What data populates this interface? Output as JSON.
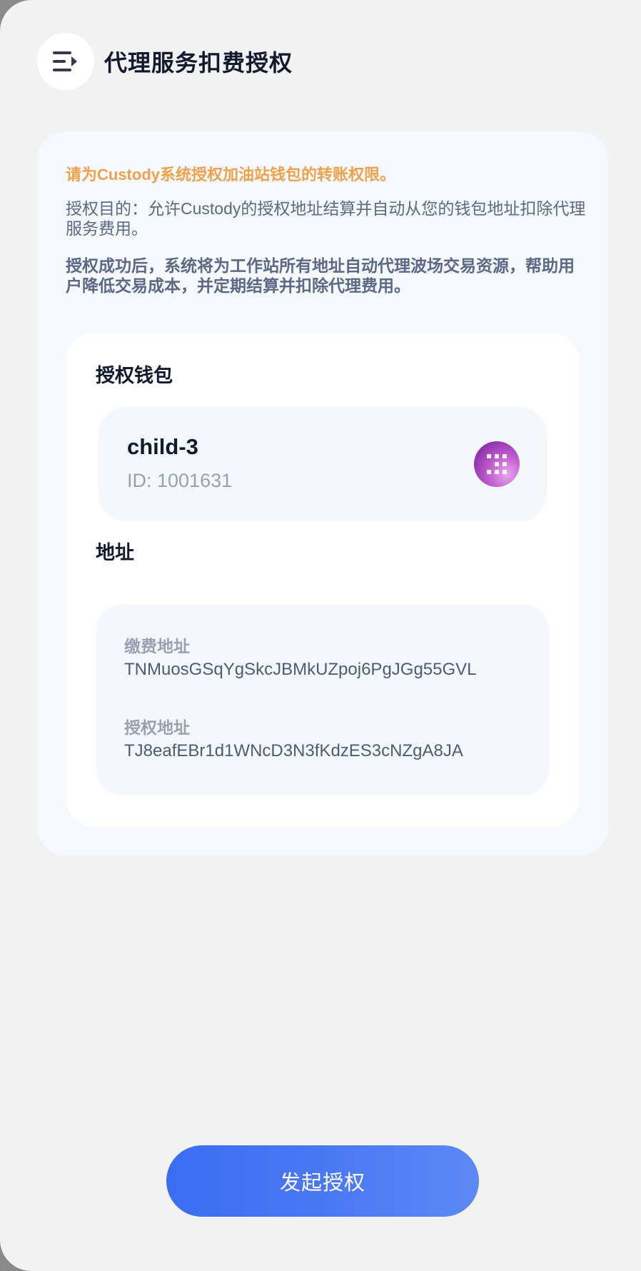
{
  "header": {
    "title": "代理服务扣费授权",
    "menu_icon": "menu-arrow-icon"
  },
  "notice": {
    "warning": "请为Custody系统授权加油站钱包的转账权限。",
    "purpose": "授权目的：允许Custody的授权地址结算并自动从您的钱包地址扣除代理服务费用。",
    "effect": "授权成功后，系统将为工作站所有地址自动代理波场交易资源，帮助用户降低交易成本，并定期结算并扣除代理费用。"
  },
  "wallet_section": {
    "label": "授权钱包",
    "wallet_name": "child-3",
    "wallet_id": "ID: 1001631",
    "avatar_icon": "wallet-avatar-icon"
  },
  "address_section": {
    "label": "地址",
    "fee_label": "缴费地址",
    "fee_address": "TNMuosGSqYgSkcJBMkUZpoj6PgJGg55GVL",
    "auth_label": "授权地址",
    "auth_address": "TJ8eafEBr1d1WNcD3N3fKdzES3cNZgA8JA"
  },
  "actions": {
    "submit_label": "发起授权"
  },
  "colors": {
    "accent": "#3b6cf3",
    "warning": "#f0a14a",
    "title": "#141a2e",
    "muted": "#9aa0b2",
    "body_text": "#5d6786"
  }
}
